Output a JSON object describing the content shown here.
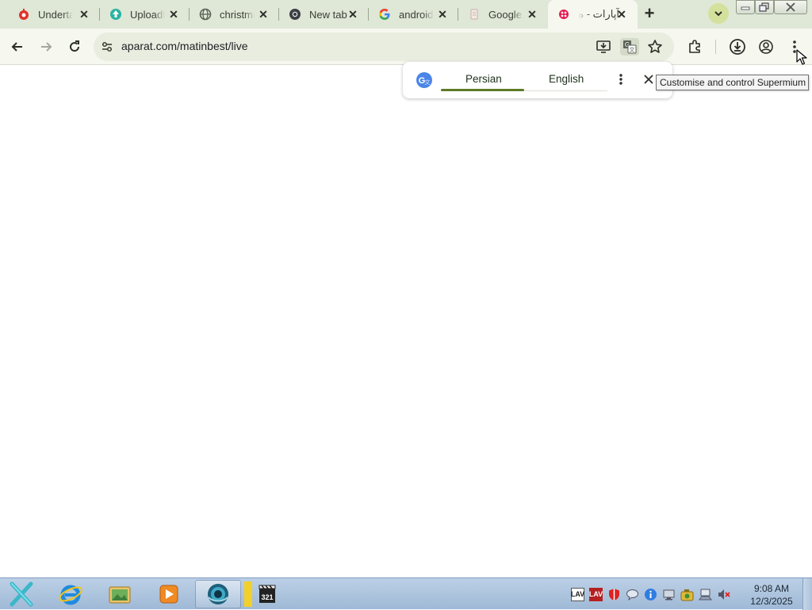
{
  "tabs": [
    {
      "title": "Underta",
      "icon": "flame-icon",
      "active": false
    },
    {
      "title": "UploadH",
      "icon": "upload-icon",
      "active": false
    },
    {
      "title": "christma",
      "icon": "globe-icon",
      "active": false
    },
    {
      "title": "New tab",
      "icon": "chrome-icon",
      "active": false
    },
    {
      "title": "android",
      "icon": "google-icon",
      "active": false
    },
    {
      "title": "Google",
      "icon": "doc-icon",
      "active": false
    },
    {
      "title": "آپارات - ه",
      "icon": "aparat-icon",
      "active": true
    }
  ],
  "address_bar": {
    "url": "aparat.com/matinbest/live"
  },
  "translate_bubble": {
    "languages": [
      "Persian",
      "English"
    ],
    "selected": "Persian"
  },
  "tooltip": "Customise and control Supermium",
  "taskbar": {
    "clock_time": "9:08 AM",
    "clock_date": "12/3/2025",
    "apps": [
      "start-icon",
      "internet-explorer-icon",
      "file-explorer-icon",
      "media-player-icon",
      "supermium-icon",
      "media-player-classic-icon"
    ]
  },
  "colors": {
    "tabstrip": "#dfe7d7",
    "toolbar": "#f6f7ef",
    "accent": "#5d7a27",
    "taskbar": "#a9c1dc"
  }
}
